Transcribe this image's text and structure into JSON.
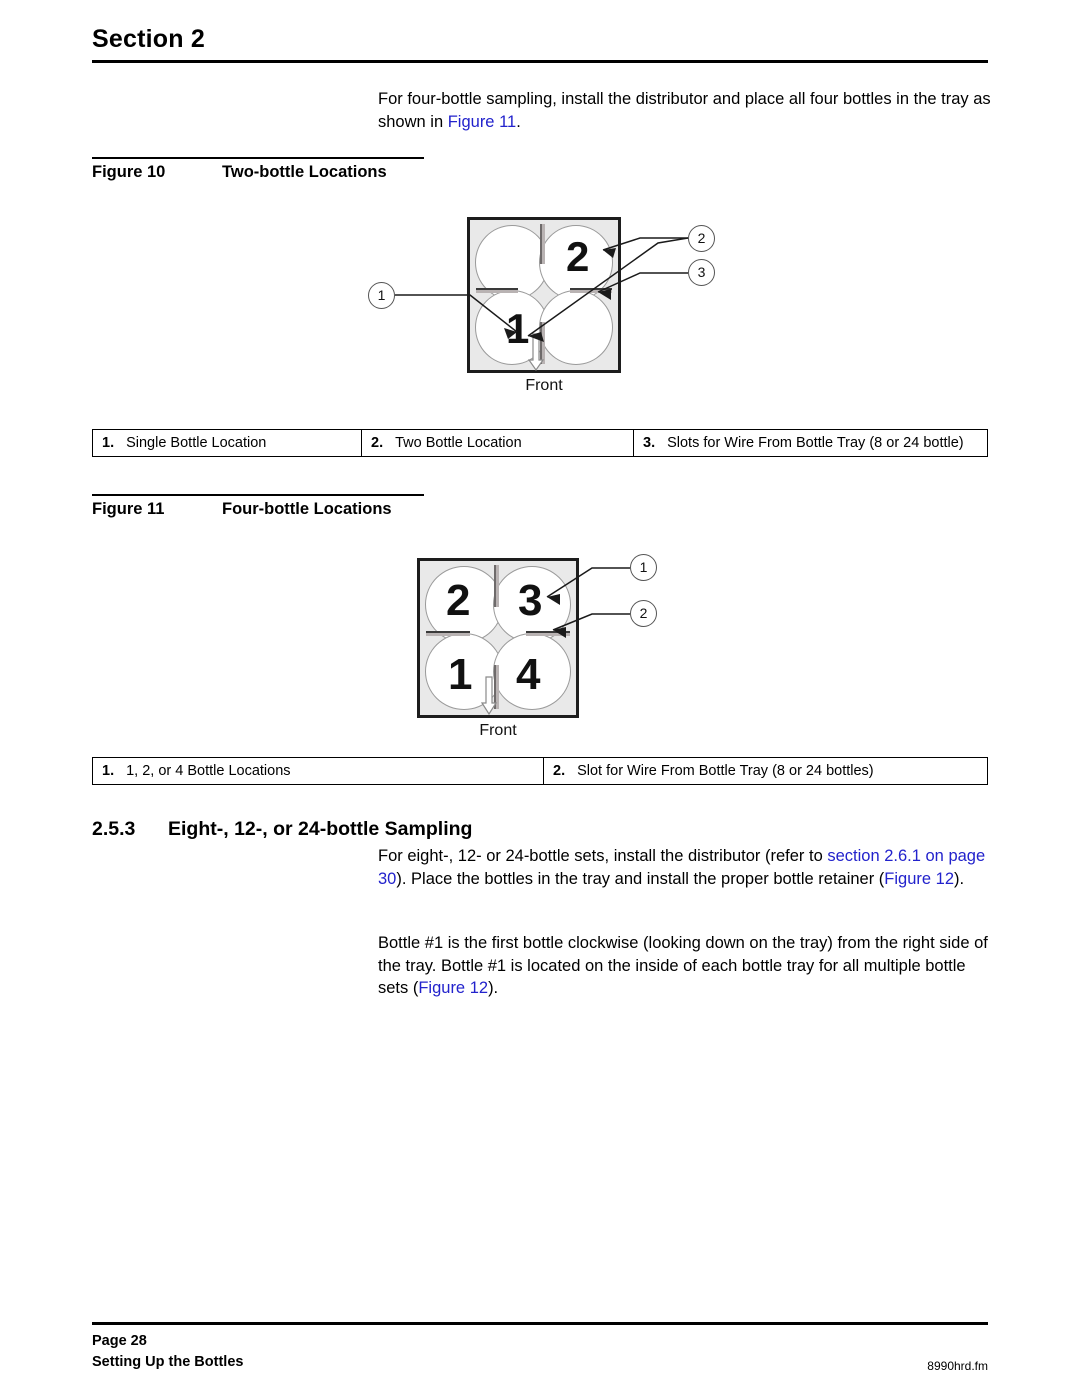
{
  "header": {
    "section_title": "Section 2"
  },
  "intro": {
    "text_before": "For four-bottle sampling, install the distributor and place all four bottles in the tray as shown in ",
    "link": "Figure 11",
    "text_after": "."
  },
  "figure10": {
    "caption_number": "Figure 10",
    "caption_title": "Two-bottle Locations",
    "tray": {
      "bottle_labels": {
        "top_left": "",
        "top_right": "2",
        "bottom_left": "1",
        "bottom_right": ""
      },
      "front_label": "Front"
    },
    "callouts": [
      "1",
      "2",
      "3"
    ],
    "legend": [
      {
        "index": "1.",
        "label": "Single Bottle Location"
      },
      {
        "index": "2.",
        "label": "Two Bottle Location"
      },
      {
        "index": "3.",
        "label": "Slots for Wire From Bottle Tray (8 or 24 bottle)"
      }
    ]
  },
  "figure11": {
    "caption_number": "Figure 11",
    "caption_title": "Four-bottle Locations",
    "tray": {
      "bottle_labels": {
        "top_left": "2",
        "top_right": "3",
        "bottom_left": "1",
        "bottom_right": "4"
      },
      "front_label": "Front"
    },
    "callouts": [
      "1",
      "2"
    ],
    "legend": [
      {
        "index": "1.",
        "label": "1, 2, or 4 Bottle Locations"
      },
      {
        "index": "2.",
        "label": "Slot for Wire From Bottle Tray (8 or 24 bottles)"
      }
    ]
  },
  "subsection": {
    "number": "2.5.3",
    "title": "Eight-, 12-, or 24-bottle Sampling"
  },
  "paragraph1": {
    "part1": "For eight-, 12- or 24-bottle sets, install the distributor (refer to ",
    "link1": "section 2.6.1 on page 30",
    "part2": "). Place the bottles in the tray and install the proper bottle retainer (",
    "link2": "Figure 12",
    "part3": ")."
  },
  "paragraph2": {
    "part1": "Bottle #1 is the first bottle clockwise (looking down on the tray) from the right side of the tray. Bottle #1 is located on the inside of each bottle tray for all multiple bottle sets (",
    "link1": "Figure 12",
    "part2": ")."
  },
  "footer": {
    "page": "Page 28",
    "chapter": "Setting Up the Bottles",
    "filename": "8990hrd.fm"
  },
  "colors": {
    "link": "#2222cc",
    "tray_fill": "#e9e9e9",
    "tray_border": "#1d1d1d"
  }
}
